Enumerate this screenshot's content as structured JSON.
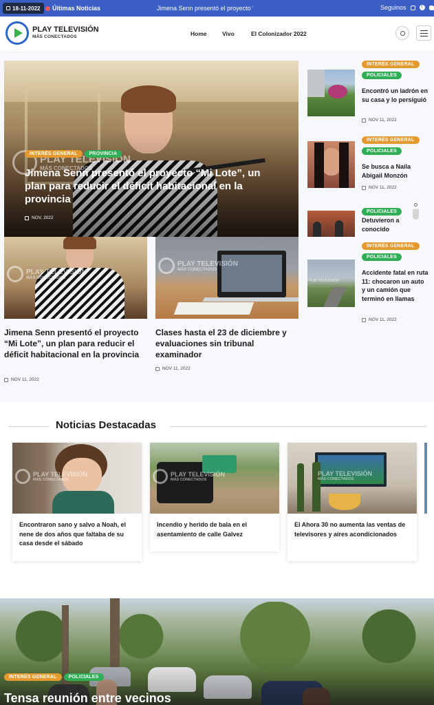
{
  "topbar": {
    "date": "18-11-2022",
    "ultimas_label": "Últimas Noticias",
    "ticker": "Jimena Senn presentó el proyecto “Mi l",
    "seguinos_label": "Seguinos",
    "social_icons": [
      "instagram-icon",
      "facebook-icon",
      "twitter-icon"
    ]
  },
  "brand": {
    "name": "PLAY TELEVISIÓN",
    "tagline": "MÁS CONECTADOS",
    "watermark_name": "PLAY TELEVISIÓN",
    "watermark_tagline": "MÁS CONECTADOS"
  },
  "nav": {
    "items": [
      "Home",
      "Vivo",
      "El Colonizador 2022"
    ]
  },
  "hero": {
    "tags": [
      "INTERÉS GENERAL",
      "PROVINCIA"
    ],
    "title": "Jimena Senn presentó el proyecto “Mi Lote”, un plan para reducir el déficit habitacional en la provincia",
    "date": "NOV, 2022"
  },
  "articles": [
    {
      "title": "Jimena Senn presentó el proyecto “Mi Lote”, un plan para reducir el déficit habitacional en la provincia",
      "date": "NOV 11, 2022"
    },
    {
      "title": "Clases hasta el 23 de diciembre y evaluaciones sin tribunal examinador",
      "date": "NOV 11, 2022"
    }
  ],
  "sidebar": [
    {
      "tags": [
        "INTERÉS GENERAL",
        "POLICIALES"
      ],
      "title": "Encontró un ladrón en su casa y lo persiguió",
      "date": "NOV 11, 2022"
    },
    {
      "tags": [
        "INTERÉS GENERAL",
        "POLICIALES"
      ],
      "title": "Se busca a Naila Abigail Monzón",
      "date": "NOV 11, 2022"
    },
    {
      "tags": [
        "POLICIALES"
      ],
      "title": "Detuvieron a conocido"
    },
    {
      "tags": [
        "INTERÉS GENERAL",
        "POLICIALES"
      ],
      "title": "Accidente fatal en ruta 11: chocaron un auto y un camión que terminó en llamas",
      "date": "NOV 11, 2022"
    }
  ],
  "destacadas": {
    "heading": "Noticias Destacadas",
    "cards": [
      {
        "title": "Encontraron sano y salvo a Noah, el nene de dos años que faltaba de su casa desde el sábado"
      },
      {
        "title": "Incendio y herido de bala en el asentamiento de calle Galvez"
      },
      {
        "title": "El Ahora 30 no aumenta las ventas de televisores y aires acondicionados"
      }
    ]
  },
  "bottom": {
    "tags": [
      "INTERÉS GENERAL",
      "POLICIALES"
    ],
    "title": "Tensa reunión entre vecinos"
  },
  "colors": {
    "topbar": "#3b5fc4",
    "tag_orange": "#e49a2e",
    "tag_green": "#2fae55",
    "logo_blue": "#2a66c8",
    "logo_green": "#35b24a"
  }
}
